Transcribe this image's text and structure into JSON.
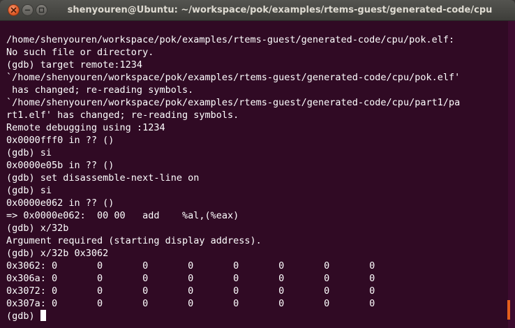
{
  "window": {
    "title": "shenyouren@Ubuntu: ~/workspace/pok/examples/rtems-guest/generated-code/cpu",
    "close_icon": "×",
    "minimize_icon": "–",
    "maximize_icon": "□"
  },
  "terminal": {
    "lines": [
      "/home/shenyouren/workspace/pok/examples/rtems-guest/generated-code/cpu/pok.elf:",
      "No such file or directory.",
      "(gdb) target remote:1234",
      "`/home/shenyouren/workspace/pok/examples/rtems-guest/generated-code/cpu/pok.elf'",
      " has changed; re-reading symbols.",
      "`/home/shenyouren/workspace/pok/examples/rtems-guest/generated-code/cpu/part1/pa",
      "rt1.elf' has changed; re-reading symbols.",
      "Remote debugging using :1234",
      "0x0000fff0 in ?? ()",
      "(gdb) si",
      "0x0000e05b in ?? ()",
      "(gdb) set disassemble-next-line on",
      "(gdb) si",
      "0x0000e062 in ?? ()",
      "=> 0x0000e062:  00 00   add    %al,(%eax)",
      "(gdb) x/32b",
      "Argument required (starting display address).",
      "(gdb) x/32b 0x3062",
      "0x3062: 0       0       0       0       0       0       0       0",
      "0x306a: 0       0       0       0       0       0       0       0",
      "0x3072: 0       0       0       0       0       0       0       0",
      "0x307a: 0       0       0       0       0       0       0       0"
    ],
    "prompt": "(gdb) "
  }
}
